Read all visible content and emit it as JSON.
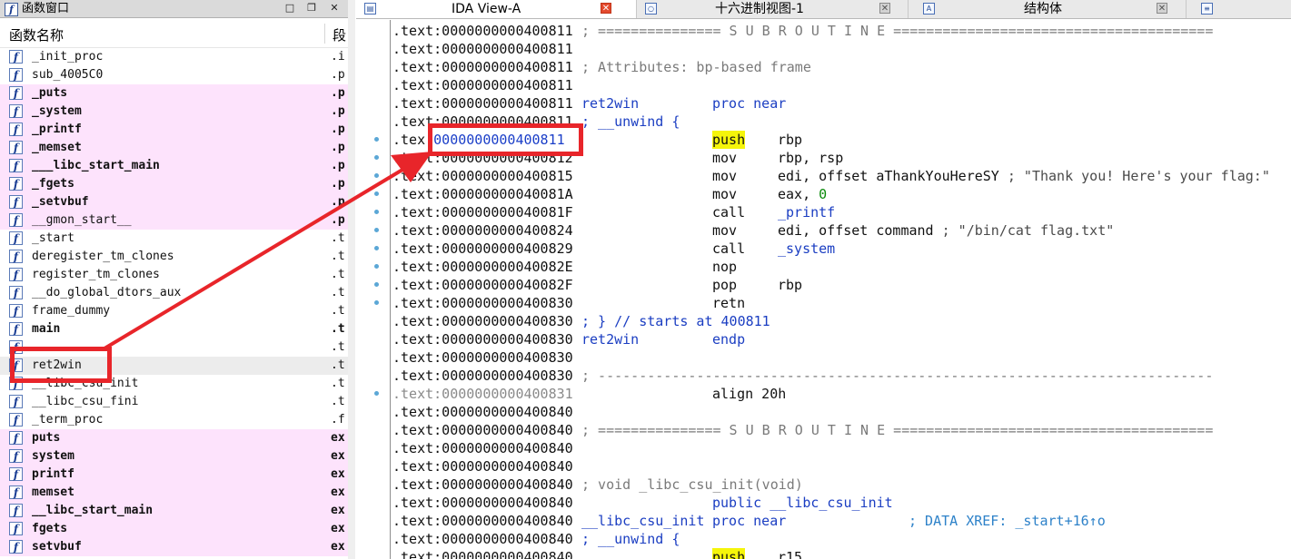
{
  "left_panel": {
    "title": "函数窗口",
    "col_name": "函数名称",
    "col_segment": "段",
    "functions": [
      {
        "name": "_init_proc",
        "seg": ".i",
        "style": "normal"
      },
      {
        "name": "sub_4005C0",
        "seg": ".p",
        "style": "normal"
      },
      {
        "name": "_puts",
        "seg": ".p",
        "style": "pink"
      },
      {
        "name": "_system",
        "seg": ".p",
        "style": "pink"
      },
      {
        "name": "_printf",
        "seg": ".p",
        "style": "pink"
      },
      {
        "name": "_memset",
        "seg": ".p",
        "style": "pink"
      },
      {
        "name": "___libc_start_main",
        "seg": ".p",
        "style": "pink"
      },
      {
        "name": "_fgets",
        "seg": ".p",
        "style": "pink"
      },
      {
        "name": "_setvbuf",
        "seg": ".p",
        "style": "pink"
      },
      {
        "name": "__gmon_start__",
        "seg": ".p",
        "style": "pinknb"
      },
      {
        "name": "_start",
        "seg": ".t",
        "style": "normal"
      },
      {
        "name": "deregister_tm_clones",
        "seg": ".t",
        "style": "normal"
      },
      {
        "name": "register_tm_clones",
        "seg": ".t",
        "style": "normal"
      },
      {
        "name": "__do_global_dtors_aux",
        "seg": ".t",
        "style": "normal"
      },
      {
        "name": "frame_dummy",
        "seg": ".t",
        "style": "normal"
      },
      {
        "name": "main",
        "seg": ".t",
        "style": "bold"
      },
      {
        "name": "",
        "seg": ".t",
        "style": "normal"
      },
      {
        "name": "ret2win",
        "seg": ".t",
        "style": "sel"
      },
      {
        "name": "__libc_csu_init",
        "seg": ".t",
        "style": "normal"
      },
      {
        "name": "__libc_csu_fini",
        "seg": ".t",
        "style": "normal"
      },
      {
        "name": "_term_proc",
        "seg": ".f",
        "style": "normal"
      },
      {
        "name": "puts",
        "seg": "ex",
        "style": "pinkbold"
      },
      {
        "name": "system",
        "seg": "ex",
        "style": "pinkbold"
      },
      {
        "name": "printf",
        "seg": "ex",
        "style": "pinkbold"
      },
      {
        "name": "memset",
        "seg": "ex",
        "style": "pinkbold"
      },
      {
        "name": "__libc_start_main",
        "seg": "ex",
        "style": "pinkbold"
      },
      {
        "name": "fgets",
        "seg": "ex",
        "style": "pinkbold"
      },
      {
        "name": "setvbuf",
        "seg": "ex",
        "style": "pinkbold"
      }
    ]
  },
  "tabs": [
    {
      "label": "IDA View-A",
      "active": true
    },
    {
      "label": "十六进制视图-1",
      "active": false
    },
    {
      "label": "结构体",
      "active": false
    }
  ],
  "code_lines": [
    {
      "addr": ".text:0000000000400811",
      "cmt": "; =============== S U B R O U T I N E ======================================="
    },
    {
      "addr": ".text:0000000000400811"
    },
    {
      "addr": ".text:0000000000400811",
      "cmt": "; Attributes: bp-based frame"
    },
    {
      "addr": ".text:0000000000400811"
    },
    {
      "addr": ".text:0000000000400811",
      "lbl": "ret2win",
      "ins": "proc near",
      "insblue": true
    },
    {
      "addr": ".text:0000000000400811",
      "cmt2": "; __unwind {"
    },
    {
      "addr_pre": ".tex",
      "addr_hl": ":0000000000400811",
      "ins": "push",
      "opd": "rbp",
      "push": true,
      "dot": true
    },
    {
      "addr": ".text:0000000000400812",
      "ins": "mov",
      "opd": "rbp, rsp",
      "dot": true
    },
    {
      "addr": ".text:0000000000400815",
      "ins": "mov",
      "opd": "edi, offset aThankYouHereSY",
      "tail": " ; \"Thank you! Here's your flag:\"",
      "dot": true
    },
    {
      "addr": ".text:000000000040081A",
      "ins": "mov",
      "opd": "eax, ",
      "num": "0",
      "dot": true
    },
    {
      "addr": ".text:000000000040081F",
      "ins": "call",
      "opd": "_printf",
      "opdblue": true,
      "dot": true
    },
    {
      "addr": ".text:0000000000400824",
      "ins": "mov",
      "opd": "edi, offset command",
      "tail": " ; \"/bin/cat flag.txt\"",
      "dot": true
    },
    {
      "addr": ".text:0000000000400829",
      "ins": "call",
      "opd": "_system",
      "opdblue": true,
      "dot": true
    },
    {
      "addr": ".text:000000000040082E",
      "ins": "nop",
      "dot": true
    },
    {
      "addr": ".text:000000000040082F",
      "ins": "pop",
      "opd": "rbp",
      "dot": true
    },
    {
      "addr": ".text:0000000000400830",
      "ins": "retn",
      "dot": true
    },
    {
      "addr": ".text:0000000000400830",
      "cmt2": "; } // starts at 400811"
    },
    {
      "addr": ".text:0000000000400830",
      "lbl": "ret2win",
      "ins": "endp",
      "insblue": true
    },
    {
      "addr": ".text:0000000000400830"
    },
    {
      "addr": ".text:0000000000400830",
      "cmt": "; ---------------------------------------------------------------------------"
    },
    {
      "addr": ".text:0000000000400831",
      "gray": true,
      "ins": "align 20h",
      "dot": true
    },
    {
      "addr": ".text:0000000000400840"
    },
    {
      "addr": ".text:0000000000400840",
      "cmt": "; =============== S U B R O U T I N E ======================================="
    },
    {
      "addr": ".text:0000000000400840"
    },
    {
      "addr": ".text:0000000000400840"
    },
    {
      "addr": ".text:0000000000400840",
      "cmt": "; void _libc_csu_init(void)"
    },
    {
      "addr": ".text:0000000000400840",
      "ins": "public __libc_csu_init",
      "insblue": true
    },
    {
      "addr": ".text:0000000000400840",
      "lbl": "__libc_csu_init",
      "ins": "proc near",
      "insblue": true,
      "xref": "; DATA XREF: _start+16↑o"
    },
    {
      "addr": ".text:0000000000400840",
      "cmt2": "; __unwind {"
    },
    {
      "addr": ".text:0000000000400840",
      "ins": "push",
      "opd": "r15",
      "push": true
    }
  ]
}
